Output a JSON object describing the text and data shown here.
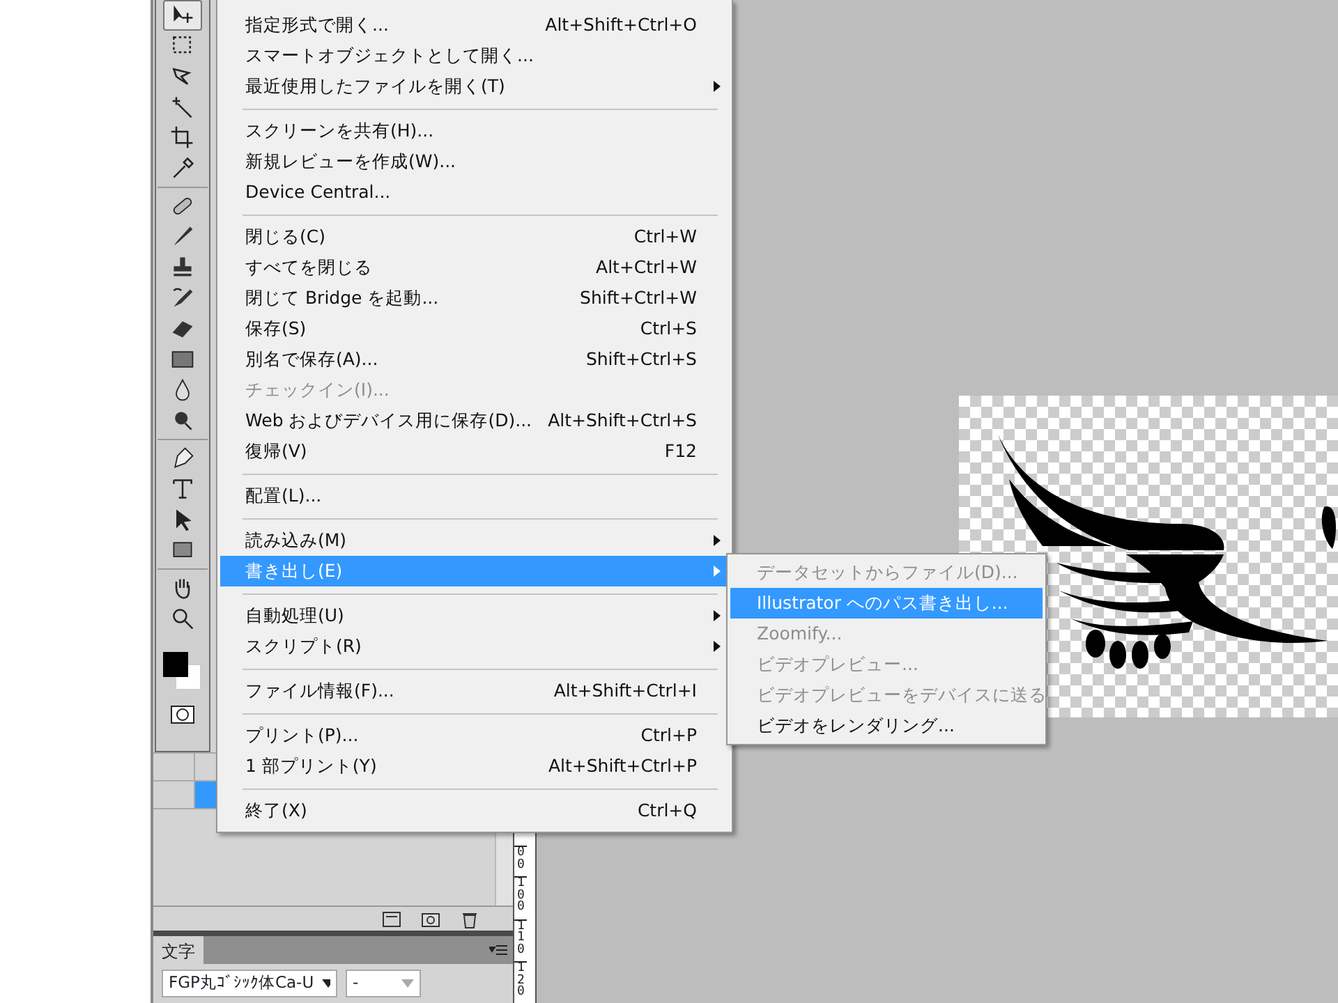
{
  "toolbox": {
    "groups": [
      {
        "tools": [
          {
            "kind": "move",
            "selected": true
          },
          {
            "kind": "marquee",
            "selected": false
          },
          {
            "kind": "lasso",
            "selected": false
          },
          {
            "kind": "wand",
            "selected": false
          },
          {
            "kind": "crop",
            "selected": false
          },
          {
            "kind": "eyedropper",
            "selected": false
          }
        ]
      },
      {
        "tools": [
          {
            "kind": "bandage",
            "selected": false
          },
          {
            "kind": "brush",
            "selected": false
          },
          {
            "kind": "stamp",
            "selected": false
          },
          {
            "kind": "history",
            "selected": false
          },
          {
            "kind": "eraser",
            "selected": false
          },
          {
            "kind": "gradient",
            "selected": false
          },
          {
            "kind": "drop",
            "selected": false
          },
          {
            "kind": "dodge",
            "selected": false
          }
        ]
      },
      {
        "tools": [
          {
            "kind": "pen",
            "selected": false
          },
          {
            "kind": "type",
            "selected": false
          },
          {
            "kind": "arrow",
            "selected": false
          },
          {
            "kind": "rect",
            "selected": false
          }
        ]
      },
      {
        "tools": [
          {
            "kind": "hand",
            "selected": false
          },
          {
            "kind": "zoom",
            "selected": false
          }
        ]
      }
    ]
  },
  "file_menu": {
    "items": [
      {
        "kind": "item",
        "label": "指定形式で開く...",
        "shortcut": "Alt+Shift+Ctrl+O",
        "submenu": false,
        "disabled": false,
        "selected": false
      },
      {
        "kind": "item",
        "label": "スマートオブジェクトとして開く...",
        "submenu": false,
        "disabled": false,
        "selected": false
      },
      {
        "kind": "item",
        "label": "最近使用したファイルを開く(T)",
        "submenu": true,
        "disabled": false,
        "selected": false
      },
      {
        "kind": "separator"
      },
      {
        "kind": "item",
        "label": "スクリーンを共有(H)...",
        "submenu": false,
        "disabled": false,
        "selected": false
      },
      {
        "kind": "item",
        "label": "新規レビューを作成(W)...",
        "submenu": false,
        "disabled": false,
        "selected": false
      },
      {
        "kind": "item",
        "label": "Device Central...",
        "submenu": false,
        "disabled": false,
        "selected": false
      },
      {
        "kind": "separator"
      },
      {
        "kind": "item",
        "label": "閉じる(C)",
        "shortcut": "Ctrl+W",
        "submenu": false,
        "disabled": false,
        "selected": false
      },
      {
        "kind": "item",
        "label": "すべてを閉じる",
        "shortcut": "Alt+Ctrl+W",
        "submenu": false,
        "disabled": false,
        "selected": false
      },
      {
        "kind": "item",
        "label": "閉じて Bridge を起動...",
        "shortcut": "Shift+Ctrl+W",
        "submenu": false,
        "disabled": false,
        "selected": false
      },
      {
        "kind": "item",
        "label": "保存(S)",
        "shortcut": "Ctrl+S",
        "submenu": false,
        "disabled": false,
        "selected": false
      },
      {
        "kind": "item",
        "label": "別名で保存(A)...",
        "shortcut": "Shift+Ctrl+S",
        "submenu": false,
        "disabled": false,
        "selected": false
      },
      {
        "kind": "item",
        "label": "チェックイン(I)...",
        "submenu": false,
        "disabled": true,
        "selected": false
      },
      {
        "kind": "item",
        "label": "Web およびデバイス用に保存(D)...",
        "shortcut": "Alt+Shift+Ctrl+S",
        "submenu": false,
        "disabled": false,
        "selected": false
      },
      {
        "kind": "item",
        "label": "復帰(V)",
        "shortcut": "F12",
        "submenu": false,
        "disabled": false,
        "selected": false
      },
      {
        "kind": "separator"
      },
      {
        "kind": "item",
        "label": "配置(L)...",
        "submenu": false,
        "disabled": false,
        "selected": false
      },
      {
        "kind": "separator"
      },
      {
        "kind": "item",
        "label": "読み込み(M)",
        "submenu": true,
        "disabled": false,
        "selected": false
      },
      {
        "kind": "item",
        "label": "書き出し(E)",
        "submenu": true,
        "disabled": false,
        "selected": true
      },
      {
        "kind": "separator"
      },
      {
        "kind": "item",
        "label": "自動処理(U)",
        "submenu": true,
        "disabled": false,
        "selected": false
      },
      {
        "kind": "item",
        "label": "スクリプト(R)",
        "submenu": true,
        "disabled": false,
        "selected": false
      },
      {
        "kind": "separator"
      },
      {
        "kind": "item",
        "label": "ファイル情報(F)...",
        "shortcut": "Alt+Shift+Ctrl+I",
        "submenu": false,
        "disabled": false,
        "selected": false
      },
      {
        "kind": "separator"
      },
      {
        "kind": "item",
        "label": "プリント(P)...",
        "shortcut": "Ctrl+P",
        "submenu": false,
        "disabled": false,
        "selected": false
      },
      {
        "kind": "item",
        "label": "1 部プリント(Y)",
        "shortcut": "Alt+Shift+Ctrl+P",
        "submenu": false,
        "disabled": false,
        "selected": false
      },
      {
        "kind": "separator"
      },
      {
        "kind": "item",
        "label": "終了(X)",
        "shortcut": "Ctrl+Q",
        "submenu": false,
        "disabled": false,
        "selected": false
      }
    ]
  },
  "export_submenu": {
    "items": [
      {
        "label": "データセットからファイル(D)...",
        "disabled": true,
        "selected": false
      },
      {
        "label": "Illustrator へのパス書き出し...",
        "disabled": false,
        "selected": true
      },
      {
        "label": "Zoomify...",
        "disabled": true,
        "selected": false
      },
      {
        "label": "ビデオプレビュー...",
        "disabled": true,
        "selected": false
      },
      {
        "label": "ビデオプレビューをデバイスに送る",
        "disabled": true,
        "selected": false
      },
      {
        "label": "ビデオをレンダリング...",
        "disabled": false,
        "selected": false
      }
    ]
  },
  "character_panel": {
    "tab": "文字",
    "font_family": "FGP丸ｺﾞｼｯｸ体Ca-U",
    "font_style": "-"
  },
  "ruler": {
    "labels": [
      "00",
      "100",
      "110",
      "120"
    ]
  }
}
